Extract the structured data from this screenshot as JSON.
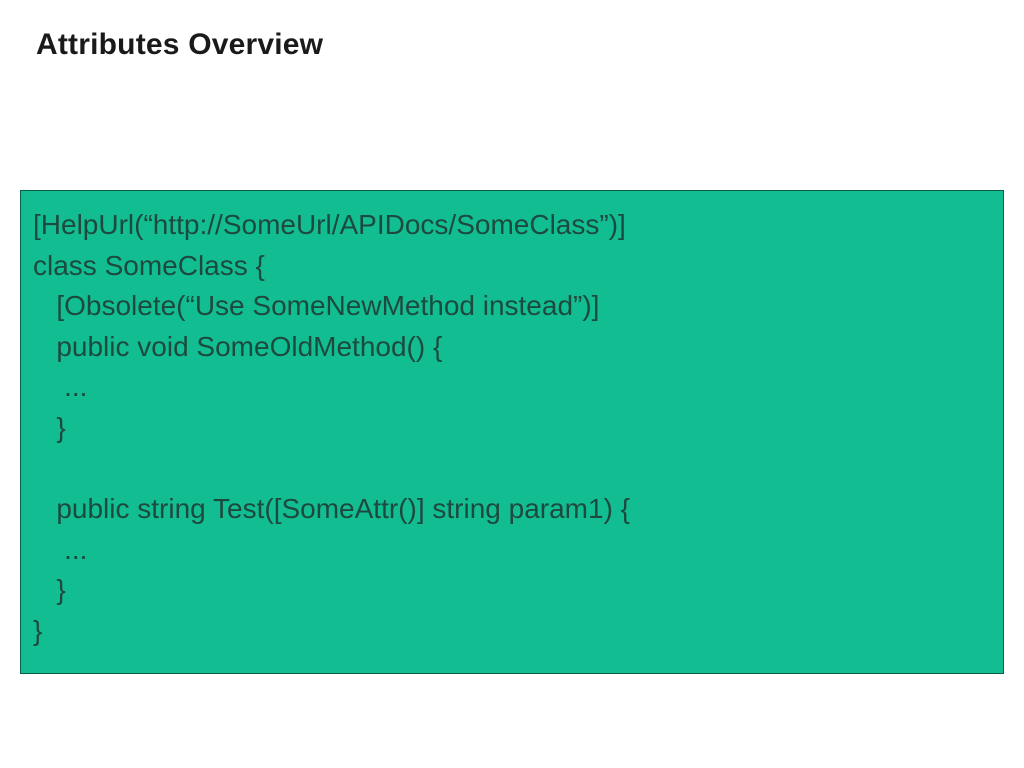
{
  "title": "Attributes Overview",
  "code": {
    "l1": "[HelpUrl(“http://SomeUrl/APIDocs/SomeClass”)]",
    "l2": "class SomeClass {",
    "l3": "   [Obsolete(“Use SomeNewMethod instead”)]",
    "l4": "   public void SomeOldMethod() {",
    "l5": "    ...",
    "l6": "   }",
    "l7": "",
    "l8": "   public string Test([SomeAttr()] string param1) {",
    "l9": "    ...",
    "l10": "   }",
    "l11": "}"
  }
}
